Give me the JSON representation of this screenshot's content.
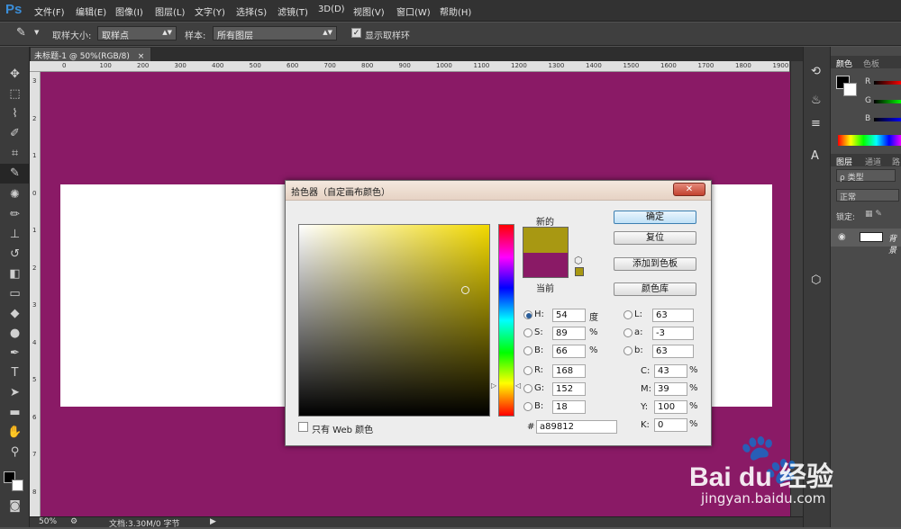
{
  "app": {
    "logo": "Ps"
  },
  "menu": [
    "文件(F)",
    "编辑(E)",
    "图像(I)",
    "图层(L)",
    "文字(Y)",
    "选择(S)",
    "滤镜(T)",
    "3D(D)",
    "视图(V)",
    "窗口(W)",
    "帮助(H)"
  ],
  "options": {
    "sample_size_label": "取样大小:",
    "sample_size_value": "取样点",
    "sample_label": "样本:",
    "sample_value": "所有图层",
    "show_ring_label": "显示取样环",
    "show_ring_checked": true
  },
  "document": {
    "tab_title": "未标题-1 @ 50%(RGB/8)",
    "tab_close": "×",
    "canvas_color": "#8a1a66",
    "zoom": "50%",
    "doc_info": "文档:3.30M/0 字节",
    "ruler_h": [
      "0",
      "100",
      "200",
      "300",
      "400",
      "500",
      "600",
      "700",
      "800",
      "900",
      "1000",
      "1100",
      "1200",
      "1300",
      "1400",
      "1500",
      "1600",
      "1700",
      "1800",
      "1900"
    ],
    "ruler_v": [
      "3",
      "2",
      "1",
      "0",
      "1",
      "2",
      "3",
      "4",
      "5",
      "6",
      "7",
      "8",
      "9"
    ]
  },
  "panels": {
    "color_tabs": [
      "颜色",
      "色板"
    ],
    "channels": [
      "R",
      "G",
      "B"
    ],
    "layer_tabs": [
      "图层",
      "通道",
      "路"
    ],
    "kind_label": "ρ 类型",
    "blend_mode": "正常",
    "lock_label": "锁定:",
    "layer_name": "背景"
  },
  "picker": {
    "title": "拾色器（自定画布颜色）",
    "close": "✕",
    "new_label": "新的",
    "current_label": "当前",
    "new_color": "#a89812",
    "current_color": "#8a1a66",
    "buttons": {
      "ok": "确定",
      "reset": "复位",
      "add_swatch": "添加到色板",
      "libraries": "颜色库"
    },
    "web_only_label": "只有 Web 颜色",
    "hsb": [
      {
        "label": "H:",
        "value": "54",
        "unit": "度",
        "selected": true
      },
      {
        "label": "S:",
        "value": "89",
        "unit": "%",
        "selected": false
      },
      {
        "label": "B:",
        "value": "66",
        "unit": "%",
        "selected": false
      }
    ],
    "rgb": [
      {
        "label": "R:",
        "value": "168"
      },
      {
        "label": "G:",
        "value": "152"
      },
      {
        "label": "B:",
        "value": "18"
      }
    ],
    "lab": [
      {
        "label": "L:",
        "value": "63"
      },
      {
        "label": "a:",
        "value": "-3"
      },
      {
        "label": "b:",
        "value": "63"
      }
    ],
    "cmyk": [
      {
        "label": "C:",
        "value": "43",
        "unit": "%"
      },
      {
        "label": "M:",
        "value": "39",
        "unit": "%"
      },
      {
        "label": "Y:",
        "value": "100",
        "unit": "%"
      },
      {
        "label": "K:",
        "value": "0",
        "unit": "%"
      }
    ],
    "hex_label": "#",
    "hex_value": "a89812"
  },
  "watermark": {
    "brand": "Bai du 经验",
    "site": "jingyan.baidu.com"
  }
}
